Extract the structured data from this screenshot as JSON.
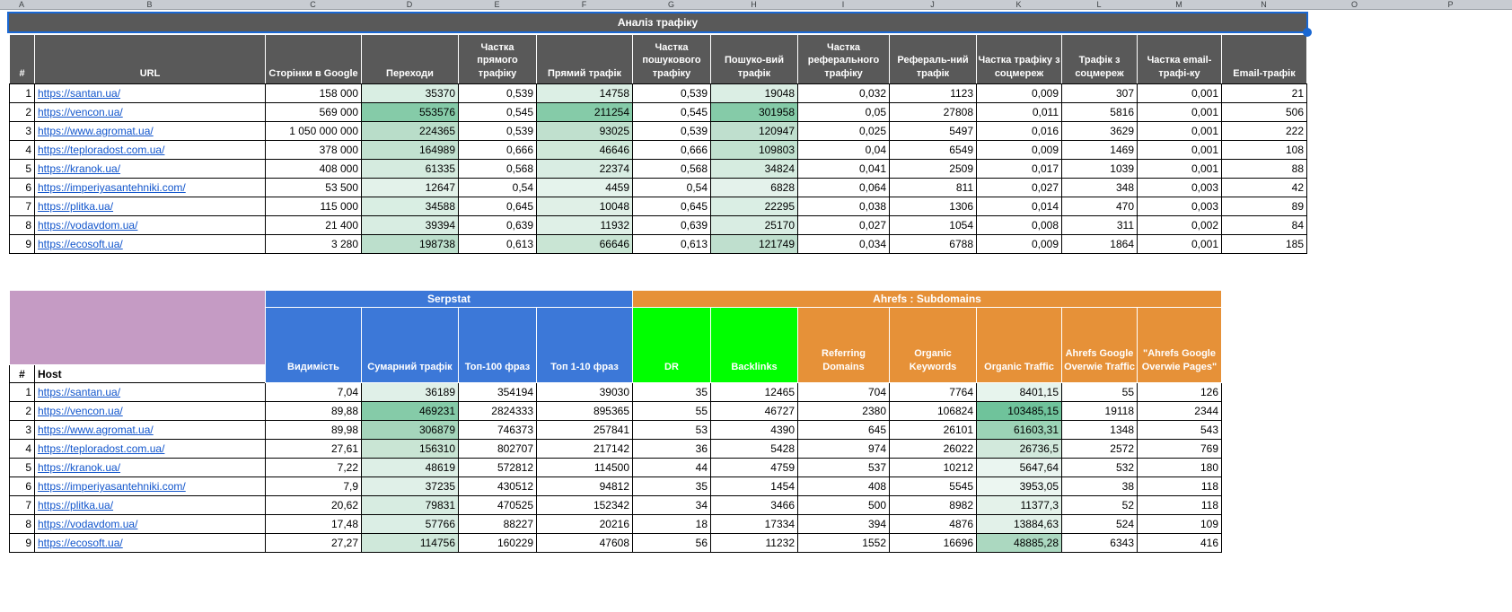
{
  "sheet": {
    "column_letters": [
      "A",
      "B",
      "C",
      "D",
      "E",
      "F",
      "G",
      "H",
      "I",
      "J",
      "K",
      "L",
      "M",
      "N",
      "O",
      "P"
    ]
  },
  "title_bar": {
    "label": "Аналіз трафіку"
  },
  "traffic_table": {
    "headers": [
      "#",
      "URL",
      "Сторінки в Google",
      "Переходи",
      "Частка прямого трафіку",
      "Прямий трафік",
      "Частка пошукового трафіку",
      "Пошуко-вий трафік",
      "Частка реферального трафіку",
      "Рефераль-ний трафік",
      "Частка трафіку з соцмереж",
      "Трафік з соцмереж",
      "Частка email-трафі-ку",
      "Email-трафік"
    ],
    "rows": [
      {
        "num": "1",
        "url": "https://santan.ua/",
        "values": [
          "158 000",
          "35370",
          "0,539",
          "14758",
          "0,539",
          "19048",
          "0,032",
          "1123",
          "0,009",
          "307",
          "0,001",
          "21"
        ],
        "value_bg": [
          "",
          "#d9eee3",
          "",
          "#dcefe5",
          "",
          "#dbeee4",
          "",
          "",
          "",
          "",
          "",
          ""
        ]
      },
      {
        "num": "2",
        "url": "https://vencon.ua/",
        "values": [
          "569 000",
          "553576",
          "0,545",
          "211254",
          "0,545",
          "301958",
          "0,05",
          "27808",
          "0,011",
          "5816",
          "0,001",
          "506"
        ],
        "value_bg": [
          "",
          "#85cba8",
          "",
          "#85cba8",
          "",
          "#85cba8",
          "",
          "",
          "",
          "",
          "",
          ""
        ]
      },
      {
        "num": "3",
        "url": "https://www.agromat.ua/",
        "values": [
          "1 050 000 000",
          "224365",
          "0,539",
          "93025",
          "0,539",
          "120947",
          "0,025",
          "5497",
          "0,016",
          "3629",
          "0,001",
          "222"
        ],
        "value_bg": [
          "",
          "#b9ddc9",
          "",
          "#c0e0ce",
          "",
          "#bfdfce",
          "",
          "",
          "",
          "",
          "",
          ""
        ]
      },
      {
        "num": "4",
        "url": "https://teploradost.com.ua/",
        "values": [
          "378 000",
          "164989",
          "0,666",
          "46646",
          "0,666",
          "109803",
          "0,04",
          "6549",
          "0,009",
          "1469",
          "0,001",
          "108"
        ],
        "value_bg": [
          "",
          "#c2e1d0",
          "",
          "#cfe8d9",
          "",
          "#c1e1cf",
          "",
          "",
          "",
          "",
          "",
          ""
        ]
      },
      {
        "num": "5",
        "url": "https://kranok.ua/",
        "values": [
          "408 000",
          "61335",
          "0,568",
          "22374",
          "0,568",
          "34824",
          "0,041",
          "2509",
          "0,017",
          "1039",
          "0,001",
          "88"
        ],
        "value_bg": [
          "",
          "#d5ebdf",
          "",
          "#d9ede3",
          "",
          "#d6ece0",
          "",
          "",
          "",
          "",
          "",
          ""
        ]
      },
      {
        "num": "6",
        "url": "https://imperiyasantehniki.com/",
        "values": [
          "53 500",
          "12647",
          "0,54",
          "4459",
          "0,54",
          "6828",
          "0,064",
          "811",
          "0,027",
          "348",
          "0,003",
          "42"
        ],
        "value_bg": [
          "",
          "#e3f2ea",
          "",
          "#e5f3ec",
          "",
          "#e4f2eb",
          "",
          "",
          "",
          "",
          "",
          ""
        ]
      },
      {
        "num": "7",
        "url": "https://plitka.ua/",
        "values": [
          "115 000",
          "34588",
          "0,645",
          "10048",
          "0,645",
          "22295",
          "0,038",
          "1306",
          "0,014",
          "470",
          "0,003",
          "89"
        ],
        "value_bg": [
          "",
          "#d9eee3",
          "",
          "#e0f0e7",
          "",
          "#daeee4",
          "",
          "",
          "",
          "",
          "",
          ""
        ]
      },
      {
        "num": "8",
        "url": "https://vodavdom.ua/",
        "values": [
          "21 400",
          "39394",
          "0,639",
          "11932",
          "0,639",
          "25170",
          "0,027",
          "1054",
          "0,008",
          "311",
          "0,002",
          "84"
        ],
        "value_bg": [
          "",
          "#d8ede2",
          "",
          "#dff0e7",
          "",
          "#d9ede3",
          "",
          "",
          "",
          "",
          "",
          ""
        ]
      },
      {
        "num": "9",
        "url": "https://ecosoft.ua/",
        "values": [
          "3 280",
          "198738",
          "0,613",
          "66646",
          "0,613",
          "121749",
          "0,034",
          "6788",
          "0,009",
          "1864",
          "0,001",
          "185"
        ],
        "value_bg": [
          "",
          "#bcdfcc",
          "",
          "#c9e5d4",
          "",
          "#bfdfce",
          "",
          "",
          "",
          "",
          "",
          ""
        ]
      }
    ]
  },
  "tools_table": {
    "corner_color": "#c59bc4",
    "groups": [
      {
        "label": "Serpstat",
        "color": "#3c78d8",
        "span": 4
      },
      {
        "label": "Ahrefs : Subdomains",
        "color": "#e69138",
        "span": 7
      }
    ],
    "columns": [
      {
        "label": "Видимість",
        "color": "#3c78d8"
      },
      {
        "label": "Сумарний трафік",
        "color": "#3c78d8"
      },
      {
        "label": "Топ-100 фраз",
        "color": "#3c78d8"
      },
      {
        "label": "Топ 1-10 фраз",
        "color": "#3c78d8"
      },
      {
        "label": "DR",
        "color": "#00ff00"
      },
      {
        "label": "Backlinks",
        "color": "#00ff00"
      },
      {
        "label": "Referring Domains",
        "color": "#e69138"
      },
      {
        "label": "Organic Keywords",
        "color": "#e69138"
      },
      {
        "label": "Organic Traffic",
        "color": "#e69138"
      },
      {
        "label": "Ahrefs Google Overwie Traffic",
        "color": "#e69138"
      },
      {
        "label": "\"Ahrefs Google Overwie Pages\"",
        "color": "#e69138"
      }
    ],
    "num_header": "#",
    "host_header": "Host",
    "rows": [
      {
        "num": "1",
        "host": "https://santan.ua/",
        "values": [
          "7,04",
          "36189",
          "354194",
          "39030",
          "35",
          "12465",
          "704",
          "7764",
          "8401,15",
          "55",
          "126"
        ],
        "value_bg": [
          "",
          "#e0f0e8",
          "",
          "",
          "",
          "",
          "",
          "",
          "#e7f4ed",
          "",
          ""
        ]
      },
      {
        "num": "2",
        "host": "https://vencon.ua/",
        "values": [
          "89,88",
          "469231",
          "2824333",
          "895365",
          "55",
          "46727",
          "2380",
          "106824",
          "103485,15",
          "19118",
          "2344"
        ],
        "value_bg": [
          "",
          "#85cba8",
          "",
          "",
          "",
          "",
          "",
          "",
          "#6fc39b",
          "",
          ""
        ]
      },
      {
        "num": "3",
        "host": "https://www.agromat.ua/",
        "values": [
          "89,98",
          "306879",
          "746373",
          "257841",
          "53",
          "4390",
          "645",
          "26101",
          "61603,31",
          "1348",
          "543"
        ],
        "value_bg": [
          "",
          "#a5d5bb",
          "",
          "",
          "",
          "",
          "",
          "",
          "#9cd3b6",
          "",
          ""
        ]
      },
      {
        "num": "4",
        "host": "https://teploradost.com.ua/",
        "values": [
          "27,61",
          "156310",
          "802707",
          "217142",
          "36",
          "5428",
          "974",
          "26022",
          "26736,5",
          "2572",
          "769"
        ],
        "value_bg": [
          "",
          "#c9e5d4",
          "",
          "",
          "",
          "",
          "",
          "",
          "#d2e9dc",
          "",
          ""
        ]
      },
      {
        "num": "5",
        "host": "https://kranok.ua/",
        "values": [
          "7,22",
          "48619",
          "572812",
          "114500",
          "44",
          "4759",
          "537",
          "10212",
          "5647,64",
          "532",
          "180"
        ],
        "value_bg": [
          "",
          "#ddefe6",
          "",
          "",
          "",
          "",
          "",
          "",
          "#eaf5f0",
          "",
          ""
        ]
      },
      {
        "num": "6",
        "host": "https://imperiyasantehniki.com/",
        "values": [
          "7,9",
          "37235",
          "430512",
          "94812",
          "35",
          "1454",
          "408",
          "5545",
          "3953,05",
          "38",
          "118"
        ],
        "value_bg": [
          "",
          "#e0f0e8",
          "",
          "",
          "",
          "",
          "",
          "",
          "#ecf6f1",
          "",
          ""
        ]
      },
      {
        "num": "7",
        "host": "https://plitka.ua/",
        "values": [
          "20,62",
          "79831",
          "470525",
          "152342",
          "34",
          "3466",
          "500",
          "8982",
          "11377,3",
          "52",
          "118"
        ],
        "value_bg": [
          "",
          "#d7ece1",
          "",
          "",
          "",
          "",
          "",
          "",
          "#e4f2ea",
          "",
          ""
        ]
      },
      {
        "num": "8",
        "host": "https://vodavdom.ua/",
        "values": [
          "17,48",
          "57766",
          "88227",
          "20216",
          "18",
          "17334",
          "394",
          "4876",
          "13884,63",
          "524",
          "109"
        ],
        "value_bg": [
          "",
          "#dbeee5",
          "",
          "",
          "",
          "",
          "",
          "",
          "#e2f1e9",
          "",
          ""
        ]
      },
      {
        "num": "9",
        "host": "https://ecosoft.ua/",
        "values": [
          "27,27",
          "114756",
          "160229",
          "47608",
          "56",
          "11232",
          "1552",
          "16696",
          "48885,28",
          "6343",
          "416"
        ],
        "value_bg": [
          "",
          "#cfe8da",
          "",
          "",
          "",
          "",
          "",
          "",
          "#abd8c0",
          "",
          ""
        ]
      }
    ]
  }
}
